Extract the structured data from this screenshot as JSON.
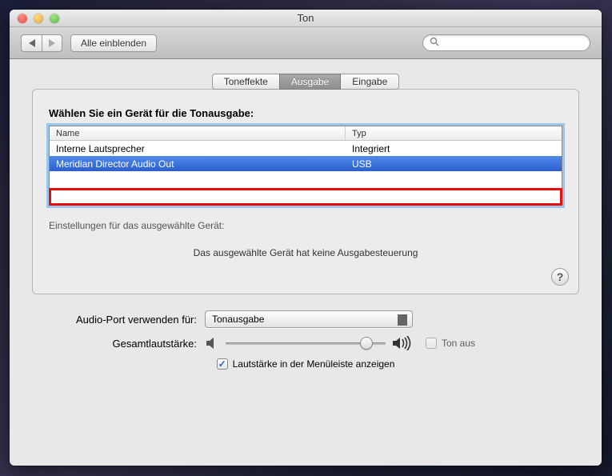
{
  "window": {
    "title": "Ton"
  },
  "toolbar": {
    "show_all_label": "Alle einblenden",
    "search_placeholder": ""
  },
  "tabs": [
    {
      "label": "Toneffekte",
      "active": false
    },
    {
      "label": "Ausgabe",
      "active": true
    },
    {
      "label": "Eingabe",
      "active": false
    }
  ],
  "output": {
    "prompt": "Wählen Sie ein Gerät für die Tonausgabe:",
    "columns": {
      "name": "Name",
      "type": "Typ"
    },
    "devices": [
      {
        "name": "Interne Lautsprecher",
        "type": "Integriert",
        "selected": false
      },
      {
        "name": "Meridian Director Audio Out",
        "type": "USB",
        "selected": true
      }
    ],
    "settings_label": "Einstellungen für das ausgewählte Gerät:",
    "no_controls": "Das ausgewählte Gerät hat keine Ausgabesteuerung"
  },
  "bottom": {
    "audio_port_label": "Audio-Port verwenden für:",
    "audio_port_value": "Tonausgabe",
    "volume_label": "Gesamtlautstärke:",
    "mute_label": "Ton aus",
    "menubar_label": "Lautstärke in der Menüleiste anzeigen",
    "menubar_checked": true
  }
}
